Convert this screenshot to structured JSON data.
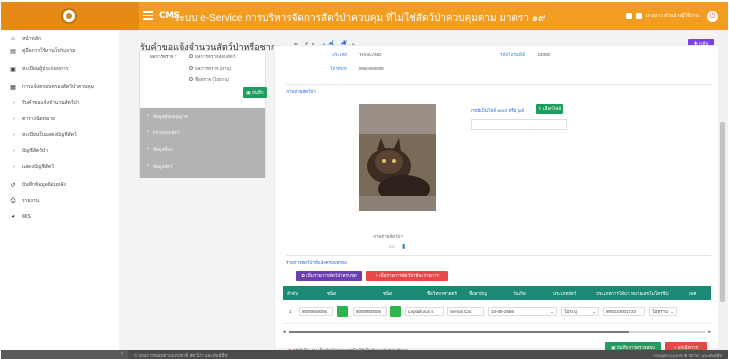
{
  "header": {
    "logo_text": "CMS",
    "title": "ระบบ e-Service การบริหารจัดการสัตว์ป่าควบคุม ที่ไม่ใช่สัตว์ป่าควบคุมตาม มาตรา ๑๙",
    "user_name": "นางสาว ตัวอย่างผู้ใช้งาน"
  },
  "sidebar": {
    "items": [
      {
        "label": "หน้าหลัก",
        "icon": "home-icon",
        "glyph": "⌂"
      },
      {
        "label": "คู่มือการใช้งานโปรแกรม",
        "icon": "book-icon",
        "glyph": "▤"
      },
      {
        "label": "ทะเบียนผู้ประกอบการ",
        "icon": "id-card-icon",
        "glyph": "▣"
      },
      {
        "label": "การแจ้งครอบครองสัตว์ป่าควบคุม",
        "icon": "list-icon",
        "glyph": "▦"
      },
      {
        "label": "รับคำขอแจ้งจำนวนสัตว์ป่า",
        "icon": "chevron-right-icon",
        "glyph": "›"
      },
      {
        "label": "ตารางนัดหมาย",
        "icon": "chevron-right-icon",
        "glyph": "›"
      },
      {
        "label": "ทะเบียนใบแสดงบัญชีสัตว์",
        "icon": "chevron-right-icon",
        "glyph": "›"
      },
      {
        "label": "บัญชีสัตว์ป่า",
        "icon": "chevron-right-icon",
        "glyph": "›"
      },
      {
        "label": "แสดงบัญชีสัตว์",
        "icon": "chevron-right-icon",
        "glyph": "›"
      },
      {
        "label": "บันทึกข้อมูลย้อนหลัง",
        "icon": "history-icon",
        "glyph": "↺"
      },
      {
        "label": "รายงาน",
        "icon": "print-icon",
        "glyph": "⎙"
      },
      {
        "label": "MIS",
        "icon": "chart-icon",
        "glyph": "◕"
      }
    ]
  },
  "page": {
    "title": "รับคำขอแจ้งจำนวนสัตว์ป่าหรือซากของสัตว์ป่า",
    "title_suffix": "(เพิ่มขึ้น)",
    "back_label": "✚ กลับ"
  },
  "left_panel": {
    "field_label": "ผลการตรวจ",
    "required_mark": "*",
    "options": [
      "ผลการตรวจสอบสัตว์",
      "ผลการตรวจ (ผ่าน)",
      "ชื่อตรวจ (ไม่ผ่าน)"
    ],
    "save_label": "บันทึก",
    "tabs": [
      {
        "label": "ข้อมูลผู้ขออนุญาต",
        "icon": "user-icon",
        "glyph": "▪"
      },
      {
        "label": "ตรวจสอบสัตว์",
        "icon": "check-icon",
        "glyph": "▪"
      },
      {
        "label": "ข้อมูลอื่นๆ",
        "icon": "info-icon",
        "glyph": "▪"
      },
      {
        "label": "ข้อมูลสัตว์",
        "icon": "paw-icon",
        "glyph": "▪"
      }
    ]
  },
  "right_panel": {
    "country_label": "ประเทศ",
    "country_value": "THAILAND",
    "postcode_label": "รหัสไปรษณีย์",
    "postcode_value": "24000",
    "phone_label": "โทรศัพท์",
    "phone_value": "0960460008",
    "photo_section": "ภาพถ่ายสัตว์ป่า",
    "photo_caption": "ภาพถ่ายสัตว์ป่า",
    "upload_note": "กรณีเป็นไฟล์ word หรือ pdf",
    "upload_label": "เลือกไฟล์",
    "table_section": "รายการสัตว์ป่าที่แจ้งครอบครอง",
    "add_button": "เพิ่มรายการสัตว์ป่าครบชุด",
    "add_red_button": "เพิ่มรายการสัตว์ป่าทีละรายการ",
    "columns": [
      "ลำดับ",
      "ชนิด",
      "ชนิด",
      "ชื่อวิทยาศาสตร์",
      "ชื่อสามัญ",
      "วันเกิด",
      "ประเภทสัตว์",
      "ประเภทการได้มา",
      "หมายเลขไมโครชิป",
      "เพศ"
    ],
    "row": {
      "index": "1",
      "code1": "9000850006",
      "code2": "9000850006",
      "scientific": "Leptailurus s",
      "common": "Serval Cat",
      "date": "10-08-2566",
      "acquire": "ไม่ระบุ",
      "microchip": "900210001723",
      "sex": "ไม่ทราบ"
    },
    "note_star": "**",
    "note": "กรณีเพิ่ม-ลบ เป็นสัตว์ป่าหลายชนิดให้เพิ่มข้อมูลกับฐานข้อมูล",
    "save_button": "บันทึกการตรวจสอบ",
    "cancel_button": "ยกเลิกการ"
  },
  "footer": {
    "copyright": "© 2023 กรมอุทยานแห่งชาติ สัตว์ป่า และพันธุ์พืช",
    "right": "กรมอุทยานแห่งชาติ สัตว์ป่า และพันธุ์พืช"
  }
}
